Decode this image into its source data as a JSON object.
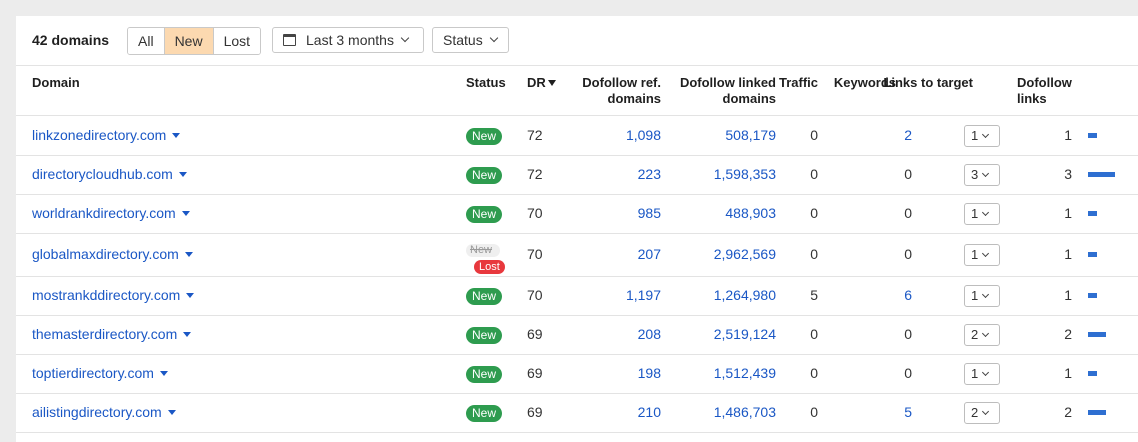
{
  "toolbar": {
    "count": "42 domains",
    "filters": [
      "All",
      "New",
      "Lost"
    ],
    "active_filter": "New",
    "period": "Last 3 months",
    "status": "Status"
  },
  "columns": {
    "domain": "Domain",
    "status": "Status",
    "dr": "DR",
    "ref_line1": "Dofollow ref.",
    "ref_line2": "domains",
    "linked_line1": "Dofollow linked",
    "linked_line2": "domains",
    "traffic": "Traffic",
    "keywords": "Keywords",
    "ltt": "Links to target",
    "dl_line1": "Dofollow",
    "dl_line2": "links"
  },
  "rows": [
    {
      "domain": "linkzonedirectory.com",
      "status": "New",
      "dr": "72",
      "ref": "1,098",
      "linked": "508,179",
      "traffic": "0",
      "keywords": "2",
      "ltt": "1",
      "dl": "1",
      "dl_value": 1
    },
    {
      "domain": "directorycloudhub.com",
      "status": "New",
      "dr": "72",
      "ref": "223",
      "linked": "1,598,353",
      "traffic": "0",
      "keywords": "0",
      "ltt": "3",
      "dl": "3",
      "dl_value": 3
    },
    {
      "domain": "worldrankdirectory.com",
      "status": "New",
      "dr": "70",
      "ref": "985",
      "linked": "488,903",
      "traffic": "0",
      "keywords": "0",
      "ltt": "1",
      "dl": "1",
      "dl_value": 1
    },
    {
      "domain": "globalmaxdirectory.com",
      "status": "Lost",
      "status_prev": "New",
      "dr": "70",
      "ref": "207",
      "linked": "2,962,569",
      "traffic": "0",
      "keywords": "0",
      "ltt": "1",
      "dl": "1",
      "dl_value": 1
    },
    {
      "domain": "mostrankddirectory.com",
      "status": "New",
      "dr": "70",
      "ref": "1,197",
      "linked": "1,264,980",
      "traffic": "5",
      "keywords": "6",
      "ltt": "1",
      "dl": "1",
      "dl_value": 1
    },
    {
      "domain": "themasterdirectory.com",
      "status": "New",
      "dr": "69",
      "ref": "208",
      "linked": "2,519,124",
      "traffic": "0",
      "keywords": "0",
      "ltt": "2",
      "dl": "2",
      "dl_value": 2
    },
    {
      "domain": "toptierdirectory.com",
      "status": "New",
      "dr": "69",
      "ref": "198",
      "linked": "1,512,439",
      "traffic": "0",
      "keywords": "0",
      "ltt": "1",
      "dl": "1",
      "dl_value": 1
    },
    {
      "domain": "ailistingdirectory.com",
      "status": "New",
      "dr": "69",
      "ref": "210",
      "linked": "1,486,703",
      "traffic": "0",
      "keywords": "5",
      "ltt": "2",
      "dl": "2",
      "dl_value": 2
    }
  ],
  "colors": {
    "link": "#1a57c5",
    "new_badge": "#2e9c4f",
    "lost_badge": "#e8383d",
    "active_filter": "#fcd9b0",
    "bar": "#2e6fd1"
  }
}
